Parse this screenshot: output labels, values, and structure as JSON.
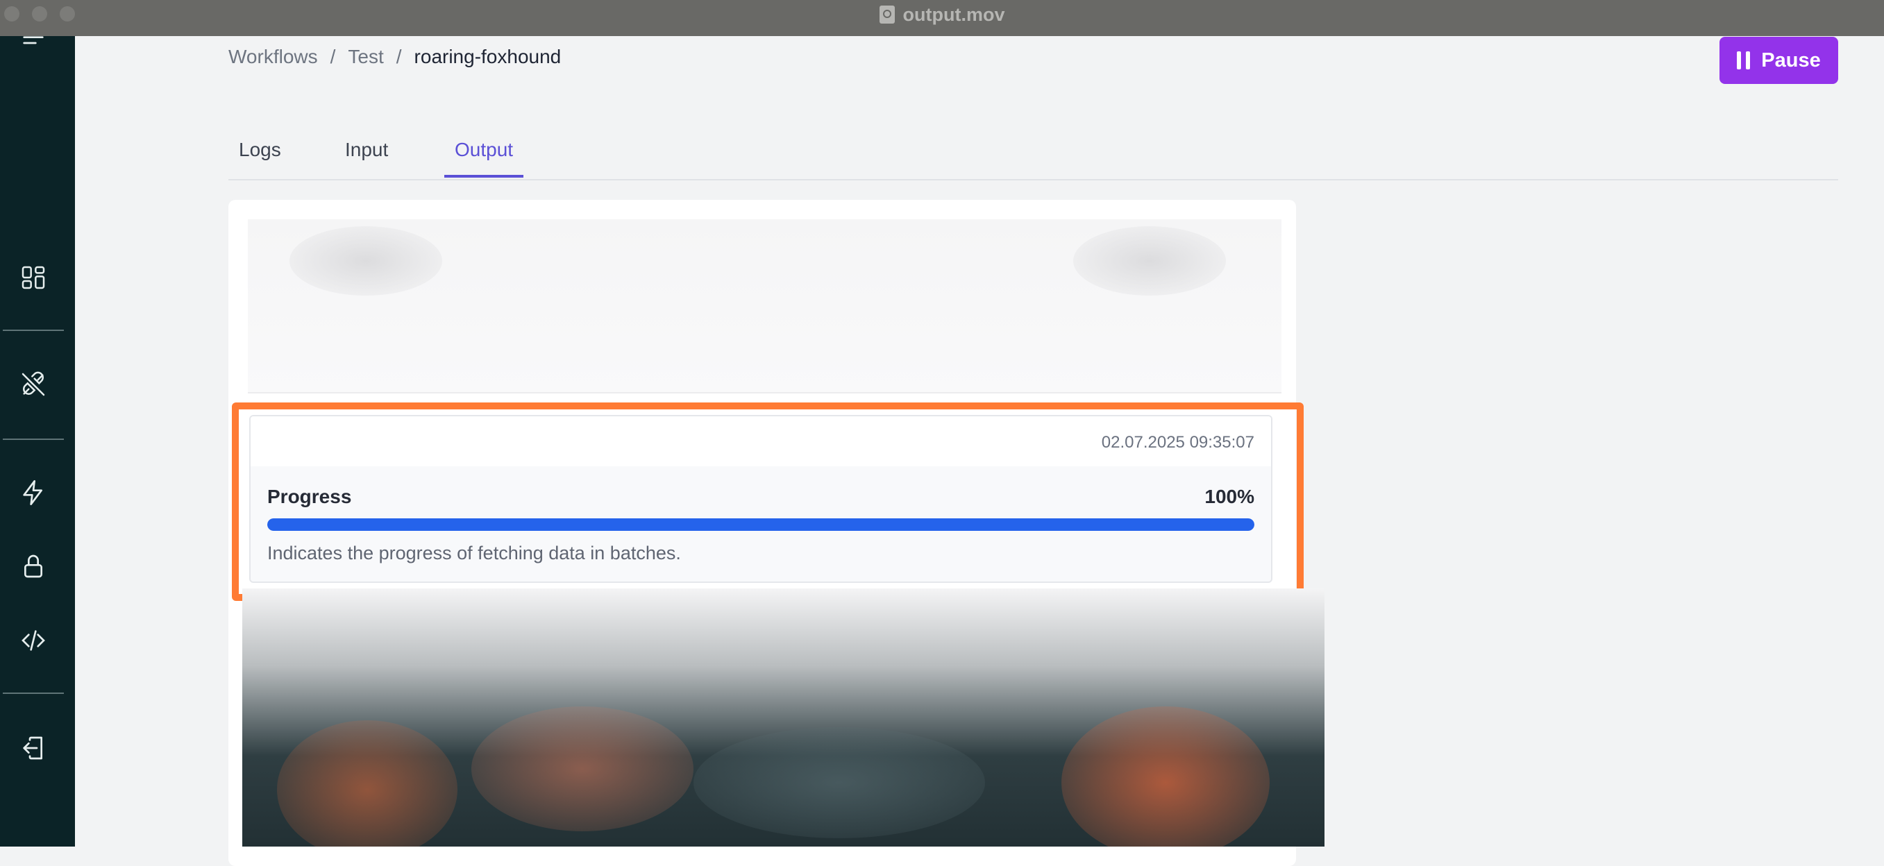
{
  "window": {
    "title": "output.mov"
  },
  "sidebar": {
    "icons": [
      "menu-icon",
      "dashboard-icon",
      "plug-icon",
      "lightning-icon",
      "lock-icon",
      "code-icon",
      "logout-icon"
    ]
  },
  "breadcrumb": {
    "items": [
      "Workflows",
      "Test",
      "roaring-foxhound"
    ],
    "separator": "/"
  },
  "header": {
    "pause_label": "Pause"
  },
  "tabs": [
    {
      "label": "Logs",
      "active": false
    },
    {
      "label": "Input",
      "active": false
    },
    {
      "label": "Output",
      "active": true
    }
  ],
  "progress": {
    "timestamp": "02.07.2025 09:35:07",
    "label": "Progress",
    "value_text": "100%",
    "value": 1.0,
    "description": "Indicates the progress of fetching data in batches."
  },
  "colors": {
    "accent": "#5b50d6",
    "pause_button": "#9333ea",
    "progress_bar": "#2563eb",
    "highlight": "#ff7b34",
    "sidebar": "#0b2327"
  }
}
